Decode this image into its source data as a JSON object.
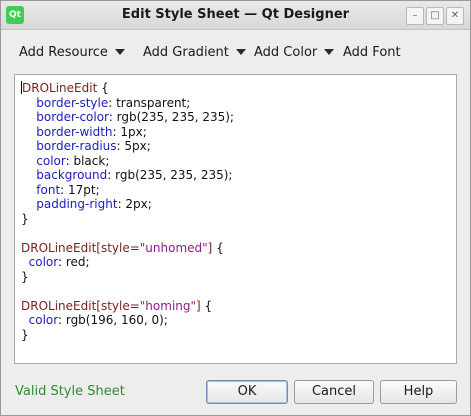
{
  "window": {
    "title": "Edit Style Sheet — Qt Designer",
    "icon_text": "Qt",
    "controls": {
      "minimize": "–",
      "maximize": "□",
      "close": "✕"
    }
  },
  "toolbar": {
    "add_resource": "Add Resource",
    "add_gradient": "Add Gradient",
    "add_color": "Add Color",
    "add_font": "Add Font"
  },
  "editor": {
    "block1": {
      "selector": "DROLineEdit",
      "open": " {",
      "props": [
        {
          "name": "border-style",
          "value": ": transparent;"
        },
        {
          "name": "border-color",
          "value": ": rgb(235, 235, 235);"
        },
        {
          "name": "border-width",
          "value": ": 1px;"
        },
        {
          "name": "border-radius",
          "value": ": 5px;"
        },
        {
          "name": "color",
          "value": ": black;"
        },
        {
          "name": "background",
          "value": ": rgb(235, 235, 235);"
        },
        {
          "name": "font",
          "value": ": 17pt;"
        },
        {
          "name": "padding-right",
          "value": ": 2px;"
        }
      ],
      "close": "}"
    },
    "block2": {
      "selector": "DROLineEdit[style=",
      "attr": "\"unhomed\"",
      "sel_end": "]",
      "open": " {",
      "prop": "color",
      "value": ": red;",
      "close": "}"
    },
    "block3": {
      "selector": "DROLineEdit[style=",
      "attr": "\"homing\"",
      "sel_end": "]",
      "open": " {",
      "prop": "color",
      "value": ": rgb(196, 160, 0);",
      "close": "}"
    }
  },
  "status": "Valid Style Sheet",
  "buttons": {
    "ok": "OK",
    "cancel": "Cancel",
    "help": "Help"
  },
  "colors": {
    "valid": "#2e8b2e",
    "selector": "#7b1e1e",
    "property": "#1d1dbd",
    "string": "#8a1e8a"
  }
}
